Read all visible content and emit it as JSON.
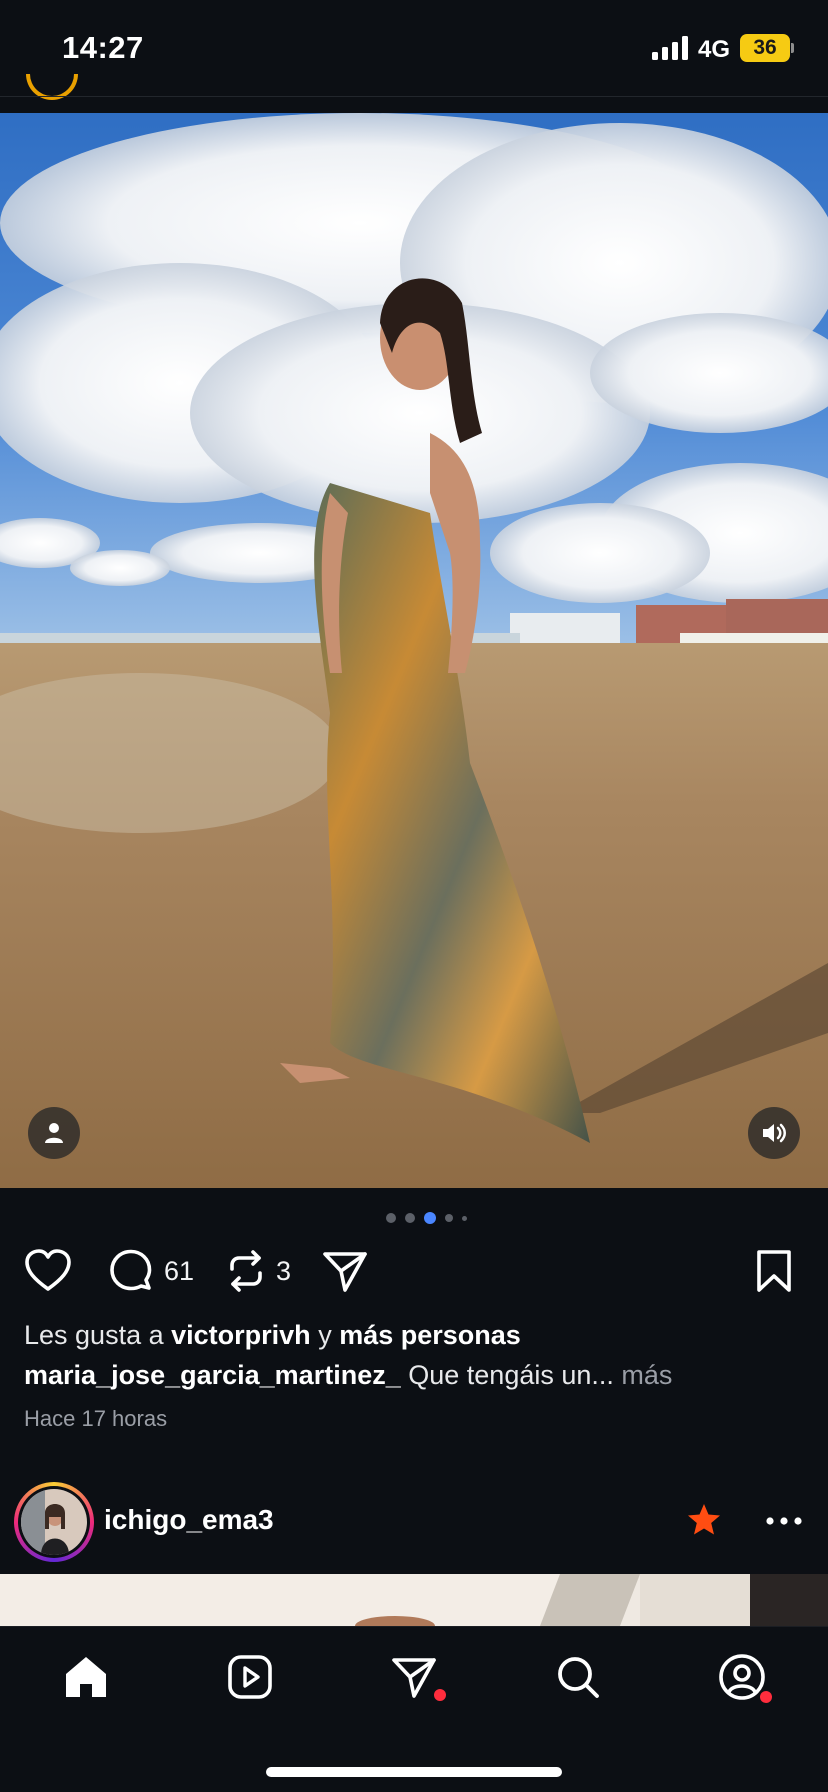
{
  "status_bar": {
    "time": "14:27",
    "network": "4G",
    "battery": "36"
  },
  "post": {
    "photo": {
      "scene": "photo",
      "user_tag_icon": "person-icon",
      "sound_icon": "speaker-icon"
    },
    "carousel": {
      "count": 5,
      "active_index": 3
    },
    "actions": {
      "comments_count": "61",
      "reposts_count": "3"
    },
    "likes": {
      "prefix": "Les gusta a",
      "user": "victorprivh",
      "joiner": "y",
      "others": "más personas"
    },
    "caption": {
      "username": "maria_jose_garcia_martinez_",
      "text": "Que tengáis un...",
      "more": "más"
    },
    "timestamp": "Hace 17 horas"
  },
  "next_post": {
    "username": "ichigo_ema3",
    "star_color": "#ff4d12"
  },
  "bottom_nav": {
    "items": [
      "home-icon",
      "reels-icon",
      "messages-icon",
      "search-icon",
      "profile-icon"
    ],
    "notification_color": "#ff2d3d"
  },
  "colors": {
    "background": "#0c0f14",
    "active_dot": "#4a86ff",
    "battery": "#f6cb13"
  }
}
